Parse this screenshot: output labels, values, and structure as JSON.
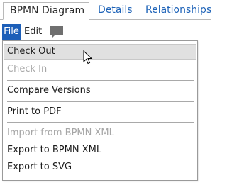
{
  "tabs": [
    {
      "label": "BPMN Diagram",
      "active": true
    },
    {
      "label": "Details",
      "active": false
    },
    {
      "label": "Relationships",
      "active": false
    }
  ],
  "menubar": {
    "file_label": "File",
    "edit_label": "Edit",
    "comment_icon": "speech-bubble-icon"
  },
  "file_menu": {
    "items": [
      {
        "label": "Check Out",
        "enabled": true,
        "hovered": true
      },
      {
        "label": "Check In",
        "enabled": false
      },
      {
        "label": "Compare Versions",
        "enabled": true
      },
      {
        "label": "Print to PDF",
        "enabled": true
      },
      {
        "label": "Import from BPMN XML",
        "enabled": false
      },
      {
        "label": "Export to BPMN XML",
        "enabled": true
      },
      {
        "label": "Export to SVG",
        "enabled": true
      }
    ]
  },
  "colors": {
    "accent": "#1d5fb8",
    "link": "#1e63b8",
    "hover_bg": "#e0e0e0",
    "disabled_text": "#a6a6a6"
  }
}
